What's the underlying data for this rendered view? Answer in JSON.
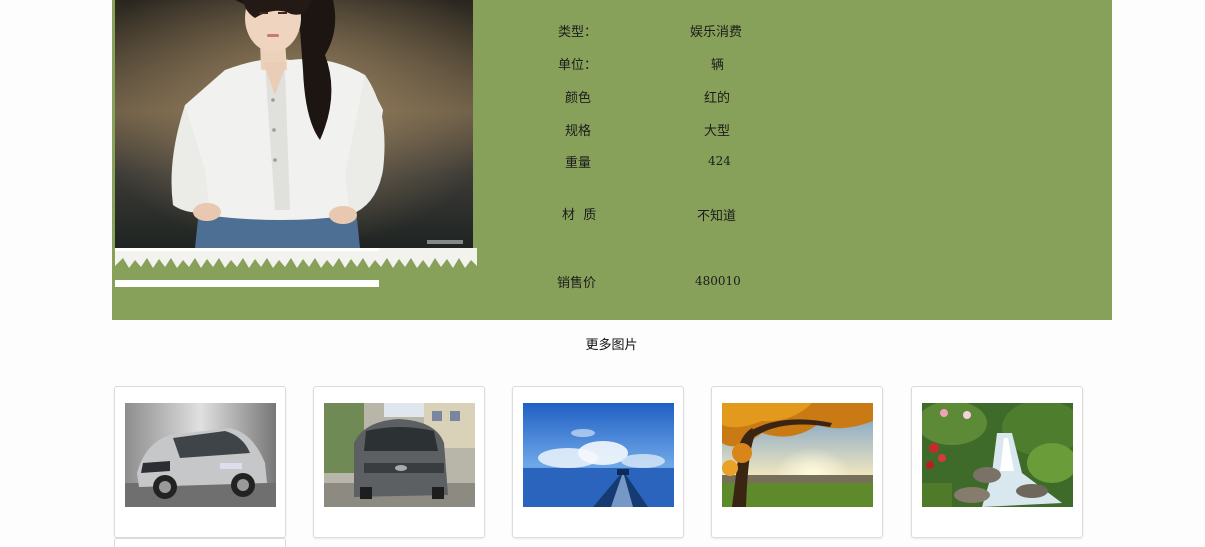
{
  "product": {
    "specs": [
      {
        "label": "类型：",
        "value": "娱乐消费"
      },
      {
        "label": "单位：",
        "value": "辆"
      },
      {
        "label": "颜色",
        "value": "红的"
      },
      {
        "label": "规格",
        "value": "大型"
      },
      {
        "label": "重量",
        "value": "424"
      },
      {
        "label": "材  质",
        "value": "不知道"
      },
      {
        "label": "销售价",
        "value": "480010"
      }
    ]
  },
  "gallery": {
    "title": "更多图片",
    "items": [
      {
        "name": "silver-hatchback"
      },
      {
        "name": "gray-van"
      },
      {
        "name": "ocean-pier"
      },
      {
        "name": "autumn-tree"
      },
      {
        "name": "garden-waterfall"
      }
    ]
  },
  "colors": {
    "panel": "#87a05a",
    "background": "#fdfdfd"
  }
}
